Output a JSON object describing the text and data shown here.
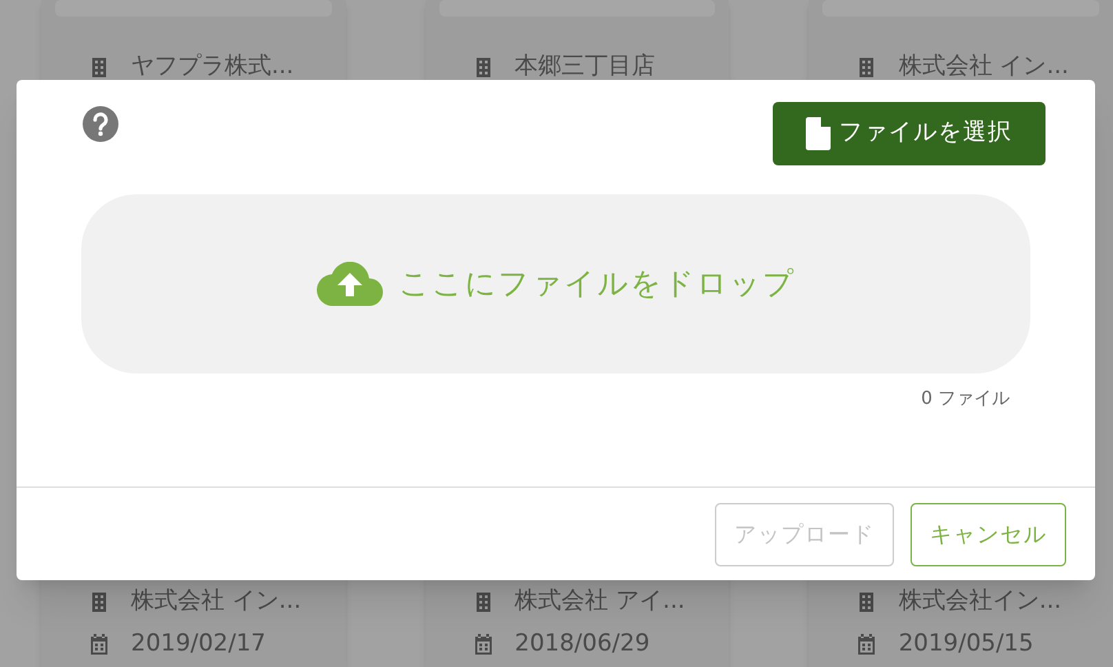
{
  "background_cards": {
    "top": [
      {
        "name": "ヤフプラ株式..."
      },
      {
        "name": "本郷三丁目店"
      },
      {
        "name": "株式会社 イン..."
      }
    ],
    "bottom": [
      {
        "name": "株式会社 イン...",
        "date": "2019/02/17"
      },
      {
        "name": "株式会社 アイ...",
        "date": "2018/06/29"
      },
      {
        "name": "株式会社イン...",
        "date": "2019/05/15"
      }
    ]
  },
  "dialog": {
    "select_button": "ファイルを選択",
    "drop_zone": "ここにファイルをドロップ",
    "file_count": "0 ファイル",
    "buttons": [
      {
        "label": "アップロード",
        "disabled": true
      },
      {
        "label": "キャンセル",
        "disabled": false
      }
    ]
  }
}
